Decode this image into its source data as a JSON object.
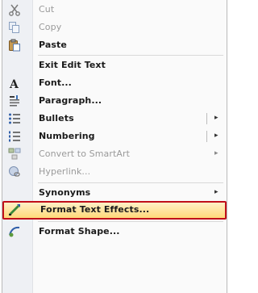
{
  "menu": {
    "items": [
      {
        "label": "Cut",
        "icon": "scissors-icon",
        "state": "disabled"
      },
      {
        "label": "Copy",
        "icon": "copy-icon",
        "state": "disabled"
      },
      {
        "label": "Paste",
        "icon": "paste-icon",
        "state": "enabled"
      },
      {
        "label": "Exit Edit Text",
        "icon": "",
        "state": "enabled"
      },
      {
        "label": "Font...",
        "icon": "font-icon",
        "state": "enabled"
      },
      {
        "label": "Paragraph...",
        "icon": "paragraph-icon",
        "state": "enabled"
      },
      {
        "label": "Bullets",
        "icon": "bullets-icon",
        "state": "enabled",
        "submenu": true
      },
      {
        "label": "Numbering",
        "icon": "numbering-icon",
        "state": "enabled",
        "submenu": true
      },
      {
        "label": "Convert to SmartArt",
        "icon": "smartart-icon",
        "state": "disabled",
        "submenu": true
      },
      {
        "label": "Hyperlink...",
        "icon": "hyperlink-icon",
        "state": "disabled"
      },
      {
        "label": "Synonyms",
        "icon": "",
        "state": "enabled",
        "submenu": true
      },
      {
        "label": "Format Text Effects...",
        "icon": "text-effects-icon",
        "state": "highlighted"
      },
      {
        "label": "Format Shape...",
        "icon": "format-shape-icon",
        "state": "enabled"
      }
    ],
    "submenu_arrow": "▸"
  },
  "colors": {
    "highlight_border": "#c0101a",
    "highlight_fill": "#ffd97a",
    "gutter": "#eef0f4"
  }
}
